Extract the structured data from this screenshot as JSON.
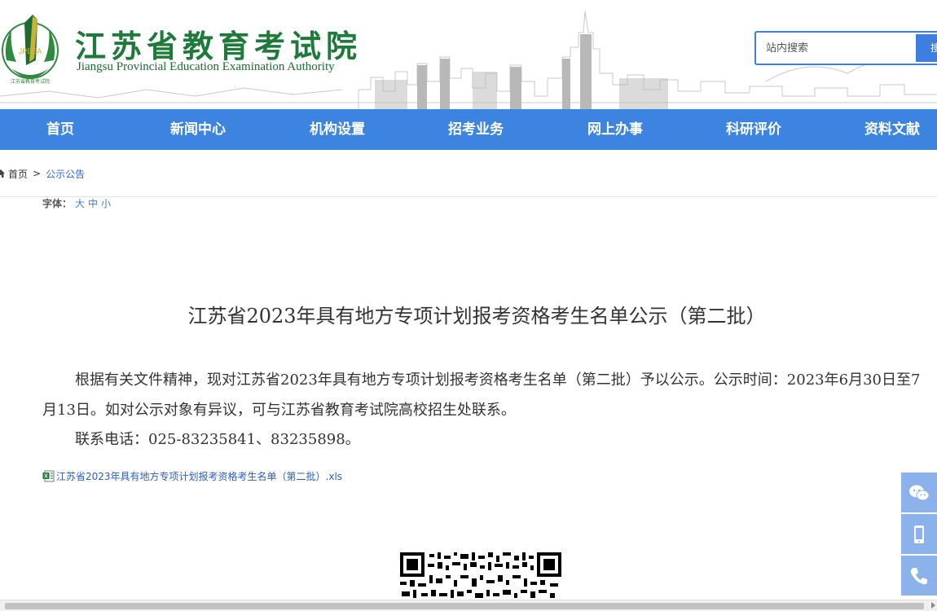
{
  "header": {
    "title_cn": "江苏省教育考试院",
    "title_en": "Jiangsu Provincial Education Examination Authority",
    "logo_text": "江苏省教育考试院",
    "search_placeholder": "站内搜索",
    "search_button": "搜"
  },
  "nav": {
    "items": [
      {
        "label": "首页"
      },
      {
        "label": "新闻中心"
      },
      {
        "label": "机构设置"
      },
      {
        "label": "招考业务"
      },
      {
        "label": "网上办事"
      },
      {
        "label": "科研评价"
      },
      {
        "label": "资料文献"
      }
    ]
  },
  "breadcrumb": {
    "home": "首页",
    "separator": ">",
    "current": "公示公告"
  },
  "font_size": {
    "label": "字体：",
    "large": "大",
    "medium": "中",
    "small": "小"
  },
  "article": {
    "title": "江苏省2023年具有地方专项计划报考资格考生名单公示（第二批）",
    "paragraph1": "根据有关文件精神，现对江苏省2023年具有地方专项计划报考资格考生名单（第二批）予以公示。公示时间：2023年6月30日至7月13日。如对公示对象有异议，可与江苏省教育考试院高校招生处联系。",
    "paragraph2": "联系电话：025-83235841、83235898。",
    "attachment": "江苏省2023年具有地方专项计划报考资格考生名单（第二批）.xls"
  },
  "float_bar": {
    "icons": [
      "wechat-icon",
      "mobile-icon",
      "phone-icon"
    ]
  },
  "colors": {
    "nav_blue": "#3d84e0",
    "title_green": "#1d7a3a",
    "link_blue": "#2b6ad8",
    "float_blue": "#8bb2ea"
  }
}
